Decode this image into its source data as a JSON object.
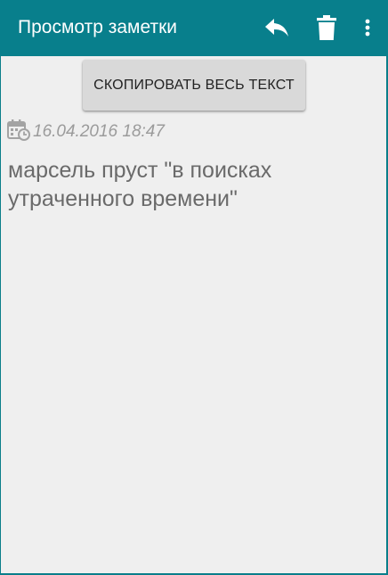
{
  "app_bar": {
    "title": "Просмотр заметки",
    "actions": [
      {
        "icon": "reply-icon"
      },
      {
        "icon": "trash-icon"
      },
      {
        "icon": "overflow-menu-icon"
      }
    ],
    "color": "#087f8c"
  },
  "main": {
    "copy_button_label": "СКОПИРОВАТЬ ВЕСЬ ТЕКСТ",
    "date_icon": "calendar-clock-icon",
    "date": "16.04.2016 18:47",
    "note_text": "марсель пруст \"в поисках утраченного времени\""
  }
}
